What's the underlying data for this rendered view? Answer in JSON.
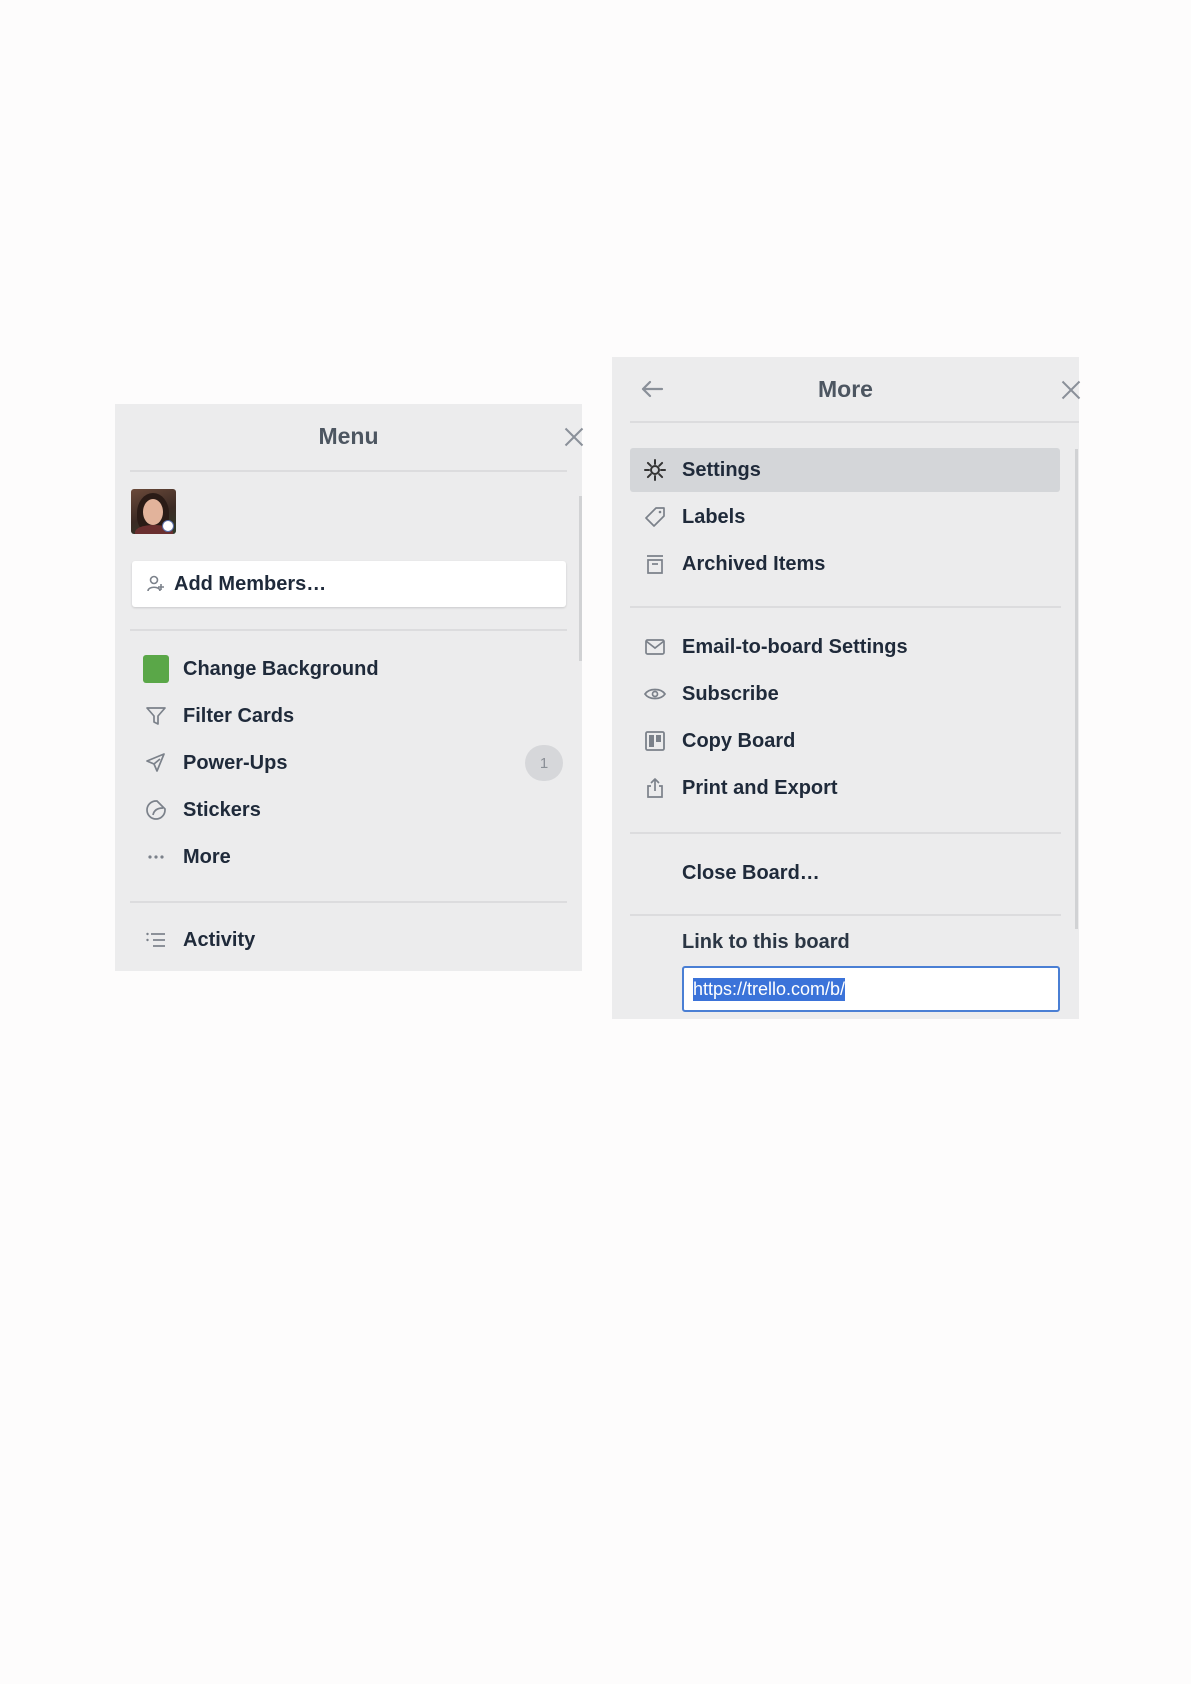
{
  "menu_panel": {
    "title": "Menu",
    "add_members_label": "Add Members…",
    "items": [
      {
        "label": "Change Background",
        "icon": "color-swatch-icon"
      },
      {
        "label": "Filter Cards",
        "icon": "filter-icon"
      },
      {
        "label": "Power-Ups",
        "icon": "rocket-icon",
        "badge": "1"
      },
      {
        "label": "Stickers",
        "icon": "sticker-icon"
      },
      {
        "label": "More",
        "icon": "ellipsis-icon"
      }
    ],
    "activity_label": "Activity",
    "background_color": "#5aa748"
  },
  "more_panel": {
    "title": "More",
    "items_group1": [
      {
        "label": "Settings",
        "icon": "gear-icon",
        "selected": true
      },
      {
        "label": "Labels",
        "icon": "tag-icon"
      },
      {
        "label": "Archived Items",
        "icon": "archive-icon"
      }
    ],
    "items_group2": [
      {
        "label": "Email-to-board Settings",
        "icon": "envelope-icon"
      },
      {
        "label": "Subscribe",
        "icon": "eye-icon"
      },
      {
        "label": "Copy Board",
        "icon": "board-icon"
      },
      {
        "label": "Print and Export",
        "icon": "share-icon"
      }
    ],
    "close_board_label": "Close Board…",
    "link_label": "Link to this board",
    "link_value": "https://trello.com/b/"
  },
  "colors": {
    "panel_bg": "#ececed",
    "accent_green": "#5aa748",
    "selection_blue": "#3b73d9"
  }
}
